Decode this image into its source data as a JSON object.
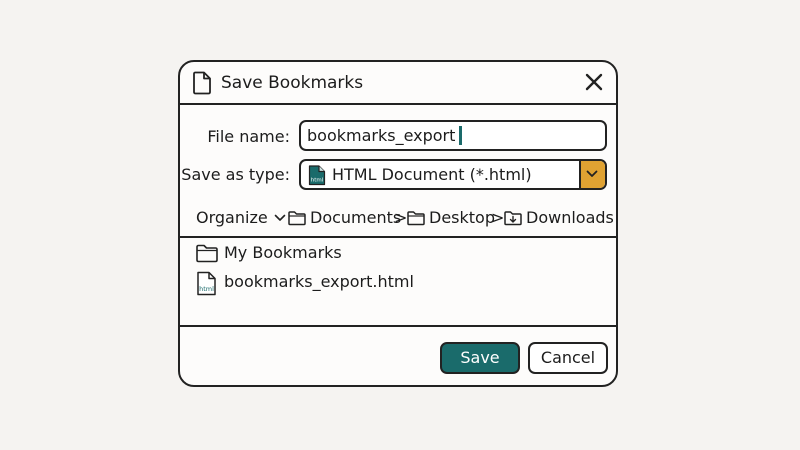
{
  "dialog": {
    "title": "Save Bookmarks"
  },
  "form": {
    "file_name_label": "File name:",
    "file_name_value": "bookmarks_export",
    "save_as_type_label": "Save as type:",
    "save_as_type_value": "HTML Document (*.html)"
  },
  "navbar": {
    "organize": "Organize",
    "path": [
      "Documents",
      "Desktop",
      "Downloads"
    ],
    "separator": ">"
  },
  "files": [
    {
      "name": "My Bookmarks",
      "icon": "folder-icon"
    },
    {
      "name": "bookmarks_export.html",
      "icon": "html-file-icon"
    }
  ],
  "icon_text": {
    "html_badge": "html"
  },
  "buttons": {
    "save": "Save",
    "cancel": "Cancel"
  },
  "colors": {
    "accent": "#1a6b6b",
    "dropdown": "#e0a232",
    "outline": "#222222"
  }
}
